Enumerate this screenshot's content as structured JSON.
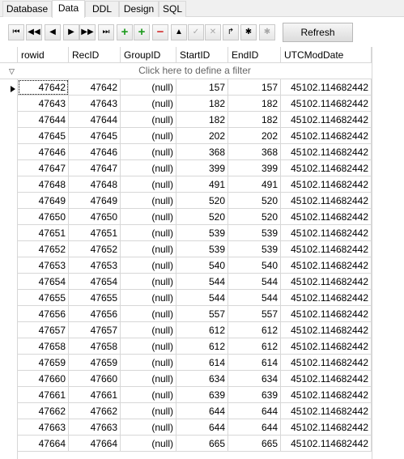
{
  "tabs": [
    {
      "label": "Database",
      "active": false
    },
    {
      "label": "Data",
      "active": true
    },
    {
      "label": "DDL",
      "active": false
    },
    {
      "label": "Design",
      "active": false
    },
    {
      "label": "SQL",
      "active": false
    }
  ],
  "toolbar": {
    "buttons": [
      {
        "name": "first-record-button",
        "icon": "first-icon",
        "glyph": "⏮"
      },
      {
        "name": "prev-page-button",
        "icon": "rewind-icon",
        "glyph": "◀◀"
      },
      {
        "name": "prev-record-button",
        "icon": "prev-icon",
        "glyph": "◀"
      },
      {
        "name": "next-record-button",
        "icon": "next-icon",
        "glyph": "▶"
      },
      {
        "name": "next-page-button",
        "icon": "fast-forward-icon",
        "glyph": "▶▶"
      },
      {
        "name": "last-record-button",
        "icon": "last-icon",
        "glyph": "⏭"
      },
      {
        "name": "insert-record-button",
        "icon": "plus-icon",
        "glyph": "+"
      },
      {
        "name": "insert-copy-button",
        "icon": "plus-copy-icon",
        "glyph": "+"
      },
      {
        "name": "delete-record-button",
        "icon": "minus-icon",
        "glyph": "−"
      },
      {
        "name": "edit-record-button",
        "icon": "up-arrow-icon",
        "glyph": "▲"
      },
      {
        "name": "post-edit-button",
        "icon": "check-icon",
        "glyph": "✓"
      },
      {
        "name": "cancel-edit-button",
        "icon": "x-icon",
        "glyph": "✕"
      },
      {
        "name": "refresh-data-button",
        "icon": "redo-arrow-icon",
        "glyph": "↱"
      },
      {
        "name": "apply-updates-button",
        "icon": "asterisk-icon",
        "glyph": "✱"
      },
      {
        "name": "cancel-updates-button",
        "icon": "asterisk-gray-icon",
        "glyph": "✱"
      }
    ],
    "refresh_label": "Refresh"
  },
  "grid": {
    "columns": [
      "rowid",
      "RecID",
      "GroupID",
      "StartID",
      "EndID",
      "UTCModDate"
    ],
    "filter_placeholder": "Click here to define a filter",
    "rows": [
      [
        "47642",
        "47642",
        "(null)",
        "157",
        "157",
        "45102.114682442"
      ],
      [
        "47643",
        "47643",
        "(null)",
        "182",
        "182",
        "45102.114682442"
      ],
      [
        "47644",
        "47644",
        "(null)",
        "182",
        "182",
        "45102.114682442"
      ],
      [
        "47645",
        "47645",
        "(null)",
        "202",
        "202",
        "45102.114682442"
      ],
      [
        "47646",
        "47646",
        "(null)",
        "368",
        "368",
        "45102.114682442"
      ],
      [
        "47647",
        "47647",
        "(null)",
        "399",
        "399",
        "45102.114682442"
      ],
      [
        "47648",
        "47648",
        "(null)",
        "491",
        "491",
        "45102.114682442"
      ],
      [
        "47649",
        "47649",
        "(null)",
        "520",
        "520",
        "45102.114682442"
      ],
      [
        "47650",
        "47650",
        "(null)",
        "520",
        "520",
        "45102.114682442"
      ],
      [
        "47651",
        "47651",
        "(null)",
        "539",
        "539",
        "45102.114682442"
      ],
      [
        "47652",
        "47652",
        "(null)",
        "539",
        "539",
        "45102.114682442"
      ],
      [
        "47653",
        "47653",
        "(null)",
        "540",
        "540",
        "45102.114682442"
      ],
      [
        "47654",
        "47654",
        "(null)",
        "544",
        "544",
        "45102.114682442"
      ],
      [
        "47655",
        "47655",
        "(null)",
        "544",
        "544",
        "45102.114682442"
      ],
      [
        "47656",
        "47656",
        "(null)",
        "557",
        "557",
        "45102.114682442"
      ],
      [
        "47657",
        "47657",
        "(null)",
        "612",
        "612",
        "45102.114682442"
      ],
      [
        "47658",
        "47658",
        "(null)",
        "612",
        "612",
        "45102.114682442"
      ],
      [
        "47659",
        "47659",
        "(null)",
        "614",
        "614",
        "45102.114682442"
      ],
      [
        "47660",
        "47660",
        "(null)",
        "634",
        "634",
        "45102.114682442"
      ],
      [
        "47661",
        "47661",
        "(null)",
        "639",
        "639",
        "45102.114682442"
      ],
      [
        "47662",
        "47662",
        "(null)",
        "644",
        "644",
        "45102.114682442"
      ],
      [
        "47663",
        "47663",
        "(null)",
        "644",
        "644",
        "45102.114682442"
      ],
      [
        "47664",
        "47664",
        "(null)",
        "665",
        "665",
        "45102.114682442"
      ]
    ]
  },
  "colors": {
    "toolbar_green": "#1e9b1e",
    "toolbar_red": "#d23030",
    "gridline": "#d7d7d7"
  }
}
